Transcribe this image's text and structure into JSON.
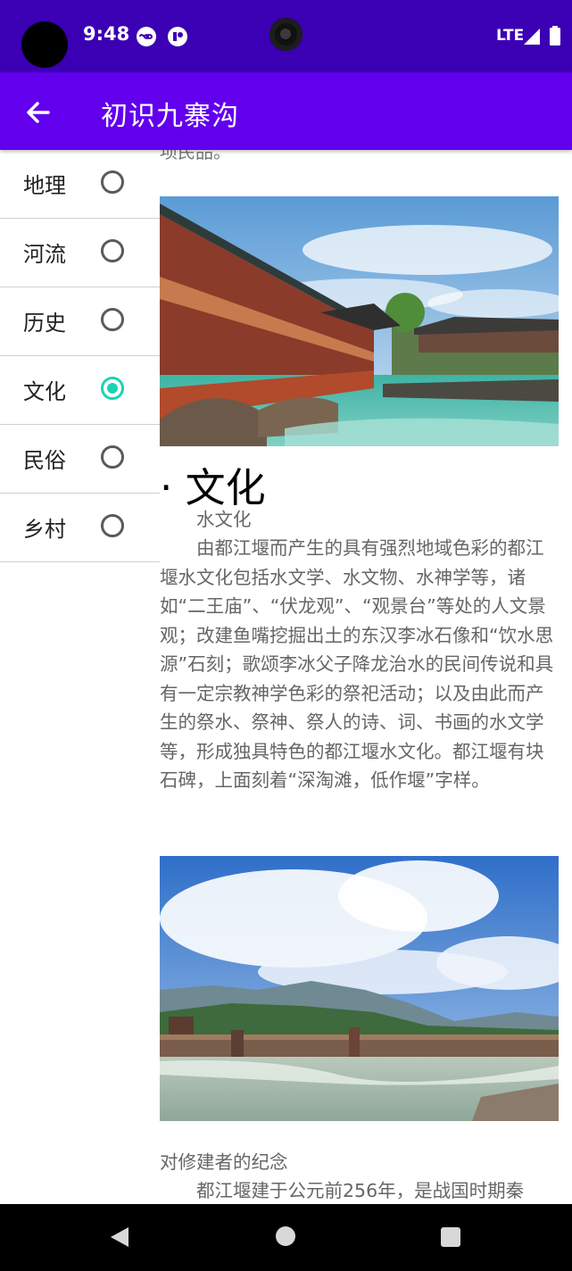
{
  "status_bar": {
    "time": "9:48",
    "network": "LTE"
  },
  "app_bar": {
    "title": "初识九寨沟",
    "back_icon": "arrow-left-icon"
  },
  "sidebar": {
    "items": [
      {
        "label": "地理",
        "checked": false
      },
      {
        "label": "河流",
        "checked": false
      },
      {
        "label": "历史",
        "checked": false
      },
      {
        "label": "文化",
        "checked": true
      },
      {
        "label": "民俗",
        "checked": false
      },
      {
        "label": "乡村",
        "checked": false
      }
    ]
  },
  "content": {
    "cut_off_text": "项民品。",
    "section_title": "· 文化",
    "subheading_1": "　　水文化",
    "paragraph_1": "　　由都江堰而产生的具有强烈地域色彩的都江堰水文化包括水文学、水文物、水神学等，诸如“二王庙”、“伏龙观”、“观景台”等处的人文景观；改建鱼嘴挖掘出土的东汉李冰石像和“饮水思源”石刻；歌颂李冰父子降龙治水的民间传说和具有一定宗教神学色彩的祭祀活动；以及由此而产生的祭水、祭神、祭人的诗、词、书画的水文学等，形成独具特色的都江堰水文化。都江堰有块石碑，上面刻着“深淘滩，低作堰”字样。",
    "subheading_2": "对修建者的纪念",
    "paragraph_2": "　　都江堰建于公元前256年，是战国时期秦"
  },
  "colors": {
    "status_bar": "#3b00b3",
    "app_bar": "#6200ee",
    "radio_checked": "#1ad3b6"
  }
}
